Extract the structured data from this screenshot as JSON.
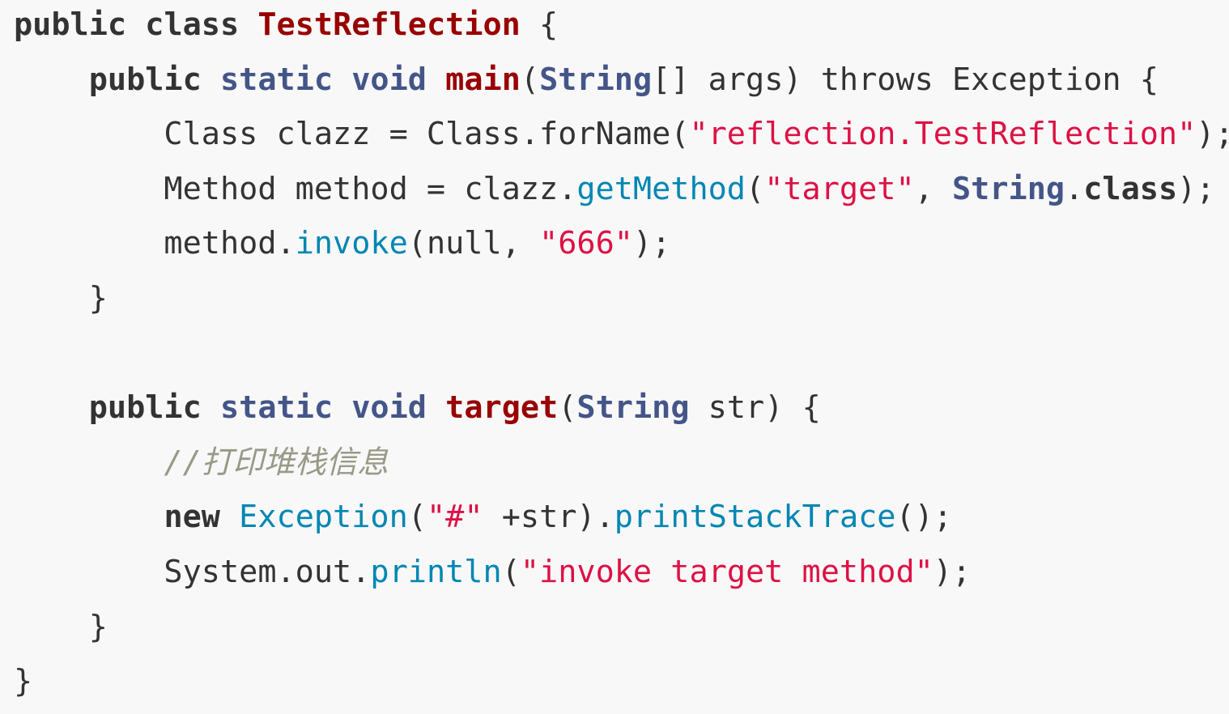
{
  "code": {
    "language": "java",
    "lines": [
      {
        "tokens": [
          {
            "t": "public",
            "k": "keyword"
          },
          {
            "t": " ",
            "k": "plain"
          },
          {
            "t": "class",
            "k": "keyword"
          },
          {
            "t": " ",
            "k": "plain"
          },
          {
            "t": "TestReflection",
            "k": "title"
          },
          {
            "t": " {",
            "k": "plain"
          }
        ]
      },
      {
        "tokens": [
          {
            "t": "    ",
            "k": "plain"
          },
          {
            "t": "public",
            "k": "keyword"
          },
          {
            "t": " ",
            "k": "plain"
          },
          {
            "t": "static",
            "k": "type-kw"
          },
          {
            "t": " ",
            "k": "plain"
          },
          {
            "t": "void",
            "k": "type-kw"
          },
          {
            "t": " ",
            "k": "plain"
          },
          {
            "t": "main",
            "k": "title"
          },
          {
            "t": "(",
            "k": "plain"
          },
          {
            "t": "String",
            "k": "type-kw"
          },
          {
            "t": "[] args) throws Exception {",
            "k": "plain"
          }
        ]
      },
      {
        "tokens": [
          {
            "t": "        Class clazz = Class.forName(",
            "k": "plain"
          },
          {
            "t": "\"reflection.TestReflection\"",
            "k": "string"
          },
          {
            "t": ");",
            "k": "plain"
          }
        ]
      },
      {
        "tokens": [
          {
            "t": "        Method method = clazz.",
            "k": "plain"
          },
          {
            "t": "getMethod",
            "k": "method"
          },
          {
            "t": "(",
            "k": "plain"
          },
          {
            "t": "\"target\"",
            "k": "string"
          },
          {
            "t": ", ",
            "k": "plain"
          },
          {
            "t": "String",
            "k": "type-kw"
          },
          {
            "t": ".",
            "k": "plain"
          },
          {
            "t": "class",
            "k": "keyword"
          },
          {
            "t": ");",
            "k": "plain"
          }
        ]
      },
      {
        "tokens": [
          {
            "t": "        method.",
            "k": "plain"
          },
          {
            "t": "invoke",
            "k": "method"
          },
          {
            "t": "(null, ",
            "k": "plain"
          },
          {
            "t": "\"666\"",
            "k": "string"
          },
          {
            "t": ");",
            "k": "plain"
          }
        ]
      },
      {
        "tokens": [
          {
            "t": "    }",
            "k": "plain"
          }
        ]
      },
      {
        "tokens": []
      },
      {
        "tokens": [
          {
            "t": "    ",
            "k": "plain"
          },
          {
            "t": "public",
            "k": "keyword"
          },
          {
            "t": " ",
            "k": "plain"
          },
          {
            "t": "static",
            "k": "type-kw"
          },
          {
            "t": " ",
            "k": "plain"
          },
          {
            "t": "void",
            "k": "type-kw"
          },
          {
            "t": " ",
            "k": "plain"
          },
          {
            "t": "target",
            "k": "title"
          },
          {
            "t": "(",
            "k": "plain"
          },
          {
            "t": "String",
            "k": "type-kw"
          },
          {
            "t": " str) {",
            "k": "plain"
          }
        ]
      },
      {
        "tokens": [
          {
            "t": "        ",
            "k": "plain"
          },
          {
            "t": "//打印堆栈信息",
            "k": "comment"
          }
        ]
      },
      {
        "tokens": [
          {
            "t": "        ",
            "k": "plain"
          },
          {
            "t": "new",
            "k": "keyword"
          },
          {
            "t": " ",
            "k": "plain"
          },
          {
            "t": "Exception",
            "k": "method"
          },
          {
            "t": "(",
            "k": "plain"
          },
          {
            "t": "\"#\"",
            "k": "string"
          },
          {
            "t": " +str).",
            "k": "plain"
          },
          {
            "t": "printStackTrace",
            "k": "method"
          },
          {
            "t": "();",
            "k": "plain"
          }
        ]
      },
      {
        "tokens": [
          {
            "t": "        System.out.",
            "k": "plain"
          },
          {
            "t": "println",
            "k": "method"
          },
          {
            "t": "(",
            "k": "plain"
          },
          {
            "t": "\"invoke target method\"",
            "k": "string"
          },
          {
            "t": ");",
            "k": "plain"
          }
        ]
      },
      {
        "tokens": [
          {
            "t": "    }",
            "k": "plain"
          }
        ]
      },
      {
        "tokens": [
          {
            "t": "}",
            "k": "plain"
          }
        ]
      }
    ]
  },
  "colors": {
    "background": "#f8f8f8",
    "plain": "#333333",
    "keyword": "#333333",
    "type_keyword": "#445588",
    "title": "#990000",
    "string": "#dd1144",
    "method": "#0086b3",
    "comment": "#999988"
  }
}
